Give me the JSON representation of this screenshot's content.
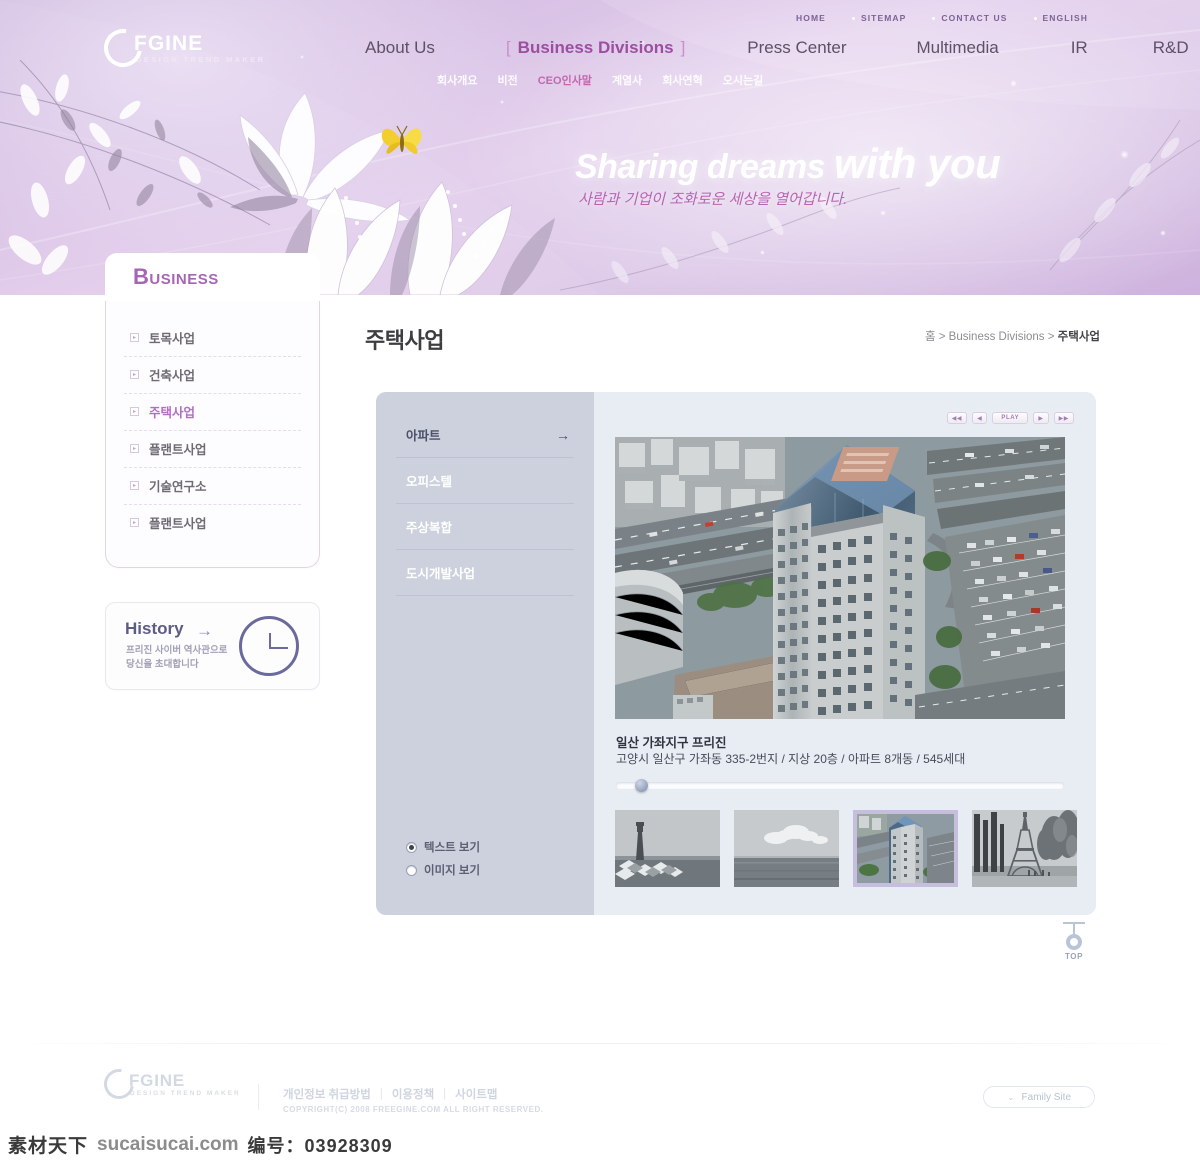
{
  "top_nav": [
    {
      "label": "HOME"
    },
    {
      "label": "SITEMAP"
    },
    {
      "label": "CONTACT US"
    },
    {
      "label": "ENGLISH"
    }
  ],
  "logo": {
    "name": "FGINE",
    "tagline": "DESIGN TREND MAKER"
  },
  "main_nav": [
    {
      "label": "About Us",
      "active": false
    },
    {
      "label": "Business Divisions",
      "active": true,
      "bracket_left": "[",
      "bracket_right": "]"
    },
    {
      "label": "Press Center",
      "active": false
    },
    {
      "label": "Multimedia",
      "active": false
    },
    {
      "label": "IR",
      "active": false
    },
    {
      "label": "R&D",
      "active": false
    }
  ],
  "sub_nav": [
    {
      "label": "회사개요",
      "highlight": false
    },
    {
      "label": "비전",
      "highlight": false
    },
    {
      "label": "CEO인사말",
      "highlight": true
    },
    {
      "label": "계열사",
      "highlight": false
    },
    {
      "label": "회사연혁",
      "highlight": false
    },
    {
      "label": "오시는길",
      "highlight": false
    }
  ],
  "hero": {
    "title_light": "Sharing dreams",
    "title_bold": "with you",
    "subtitle": "사람과 기업이 조화로운 세상을 열어갑니다."
  },
  "section_tab": {
    "label": "Business"
  },
  "sidebar": {
    "items": [
      {
        "label": "토목사업",
        "active": false
      },
      {
        "label": "건축사업",
        "active": false
      },
      {
        "label": "주택사업",
        "active": true
      },
      {
        "label": "플랜트사업",
        "active": false
      },
      {
        "label": "기술연구소",
        "active": false
      },
      {
        "label": "플랜트사업",
        "active": false
      }
    ],
    "history": {
      "title": "History",
      "arrow": "→",
      "desc_line1": "프리진 사이버 역사관으로",
      "desc_line2": "당신을 초대합니다"
    }
  },
  "content": {
    "page_title": "주택사업",
    "breadcrumb": {
      "home": "홈",
      "sep1": ">",
      "level1": "Business Divisions",
      "sep2": ">",
      "current": "주택사업"
    },
    "tabs": [
      {
        "label": "아파트",
        "active": true,
        "arrow": "→"
      },
      {
        "label": "오피스텔",
        "active": false
      },
      {
        "label": "주상복합",
        "active": false
      },
      {
        "label": "도시개발사업",
        "active": false
      }
    ],
    "view_options": [
      {
        "label": "텍스트 보기",
        "selected": true
      },
      {
        "label": "이미지 보기",
        "selected": false
      }
    ],
    "media_controls": [
      {
        "label": "◀◀",
        "name": "rewind"
      },
      {
        "label": "◀",
        "name": "prev"
      },
      {
        "label": "PLAY",
        "name": "play"
      },
      {
        "label": "▶",
        "name": "next"
      },
      {
        "label": "▶▶",
        "name": "forward"
      }
    ],
    "caption": {
      "title": "일산 가좌지구 프리진",
      "desc": "고양시 일산구 가좌동 335-2번지 / 지상 20층 / 아파트 8개동 / 545세대"
    },
    "slider_value": 4,
    "thumbnails": [
      {
        "name": "lighthouse-thumb",
        "selected": false
      },
      {
        "name": "seascape-thumb",
        "selected": false
      },
      {
        "name": "tower-building-thumb",
        "selected": true
      },
      {
        "name": "eiffel-tower-thumb",
        "selected": false
      }
    ]
  },
  "top_button": {
    "label": "TOP"
  },
  "footer": {
    "logo_name": "FGINE",
    "logo_tagline": "DESIGN TREND MAKER",
    "links": [
      {
        "label": "개인정보 취급방법"
      },
      {
        "label": "이용정책"
      },
      {
        "label": "사이트맵"
      }
    ],
    "separator": "|",
    "copyright": "COPYRIGHT(C) 2008 FREEGINE.COM ALL RIGHT RESERVED.",
    "family_site": "Family Site",
    "family_chevron": "⌄"
  },
  "watermark": {
    "cn": "素材天下",
    "url": "sucaisucai.com",
    "number": "编号：03928309"
  },
  "colors": {
    "accent_purple": "#a766b5",
    "hero_gradient_start": "#cbb6dd",
    "panel_bg": "#e8ecf3",
    "panel_left_bg": "#ccd1dd"
  }
}
